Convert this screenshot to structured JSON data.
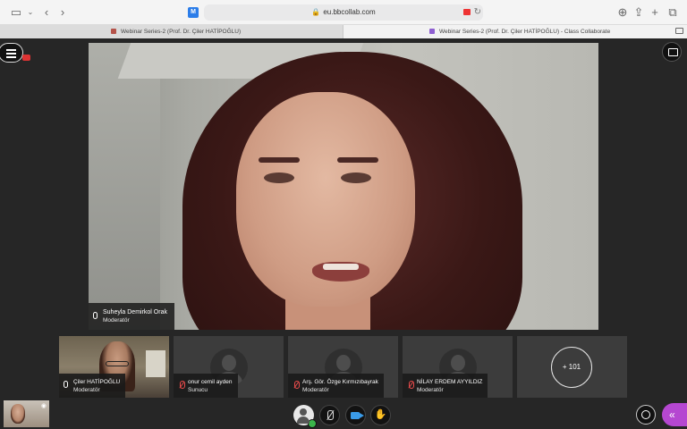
{
  "browser": {
    "url": "eu.bbcollab.com",
    "tabs": [
      {
        "label": "Webinar Series-2 (Prof. Dr. Çiler HATİPOĞLU)"
      },
      {
        "label": "Webinar Series-2 (Prof. Dr. Çiler HATİPOĞLU) - Class Collaborate"
      }
    ]
  },
  "main_video": {
    "name": "Suheyla Demirkol Orak",
    "role": "Moderatör"
  },
  "participants": [
    {
      "name": "Çiler HATİPOĞLU",
      "role": "Moderatör",
      "muted": false,
      "has_video": true
    },
    {
      "name": "onur cemil ayden",
      "role": "Sunucu",
      "muted": true,
      "has_video": false
    },
    {
      "name": "Arş. Gör. Özge Kırmızıbayrak",
      "role": "Moderatör",
      "muted": true,
      "has_video": false
    },
    {
      "name": "NİLAY ERDEM AYYILDIZ",
      "role": "Moderatör",
      "muted": true,
      "has_video": false
    }
  ],
  "more_participants": "+ 101",
  "menu_badge": "",
  "colors": {
    "accent": "#b547d1",
    "camera": "#3a9be8",
    "muted": "#e94b4b",
    "status_ok": "#3bb44a"
  }
}
